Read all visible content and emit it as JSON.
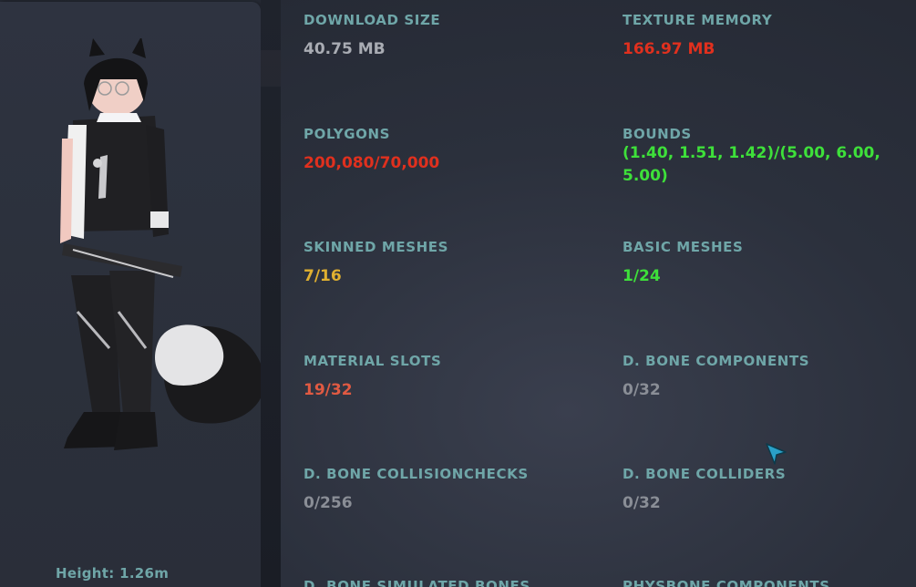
{
  "avatar": {
    "height_label": "Height: 1.26m"
  },
  "colors": {
    "label": "#6fa6a8",
    "neutral": "#a9acb3",
    "bad": "#e0301e",
    "warn": "#e0b030",
    "good": "#3ee03a",
    "mild_bad": "#e05a42",
    "dim": "#8a8e96"
  },
  "stats": {
    "download_size": {
      "label": "DOWNLOAD SIZE",
      "value": "40.75 MB",
      "status": "neutral"
    },
    "texture_memory": {
      "label": "TEXTURE MEMORY",
      "value": "166.97 MB",
      "status": "bad"
    },
    "polygons": {
      "label": "POLYGONS",
      "value": "200,080/70,000",
      "status": "bad"
    },
    "bounds": {
      "label": "BOUNDS",
      "value": "(1.40, 1.51, 1.42)/(5.00, 6.00, 5.00)",
      "status": "good"
    },
    "skinned_meshes": {
      "label": "SKINNED MESHES",
      "value": "7/16",
      "status": "warn"
    },
    "basic_meshes": {
      "label": "BASIC MESHES",
      "value": "1/24",
      "status": "good"
    },
    "material_slots": {
      "label": "MATERIAL SLOTS",
      "value": "19/32",
      "status": "mild_bad"
    },
    "d_bone_components": {
      "label": "D. BONE COMPONENTS",
      "value": "0/32",
      "status": "dim"
    },
    "d_bone_collisionchecks": {
      "label": "D. BONE COLLISIONCHECKS",
      "value": "0/256",
      "status": "dim"
    },
    "d_bone_colliders": {
      "label": "D. BONE COLLIDERS",
      "value": "0/32",
      "status": "dim"
    },
    "d_bone_simulated_bones": {
      "label": "D. BONE SIMULATED BONES"
    },
    "physbone_components": {
      "label": "PHYSBONE COMPONENTS"
    }
  }
}
